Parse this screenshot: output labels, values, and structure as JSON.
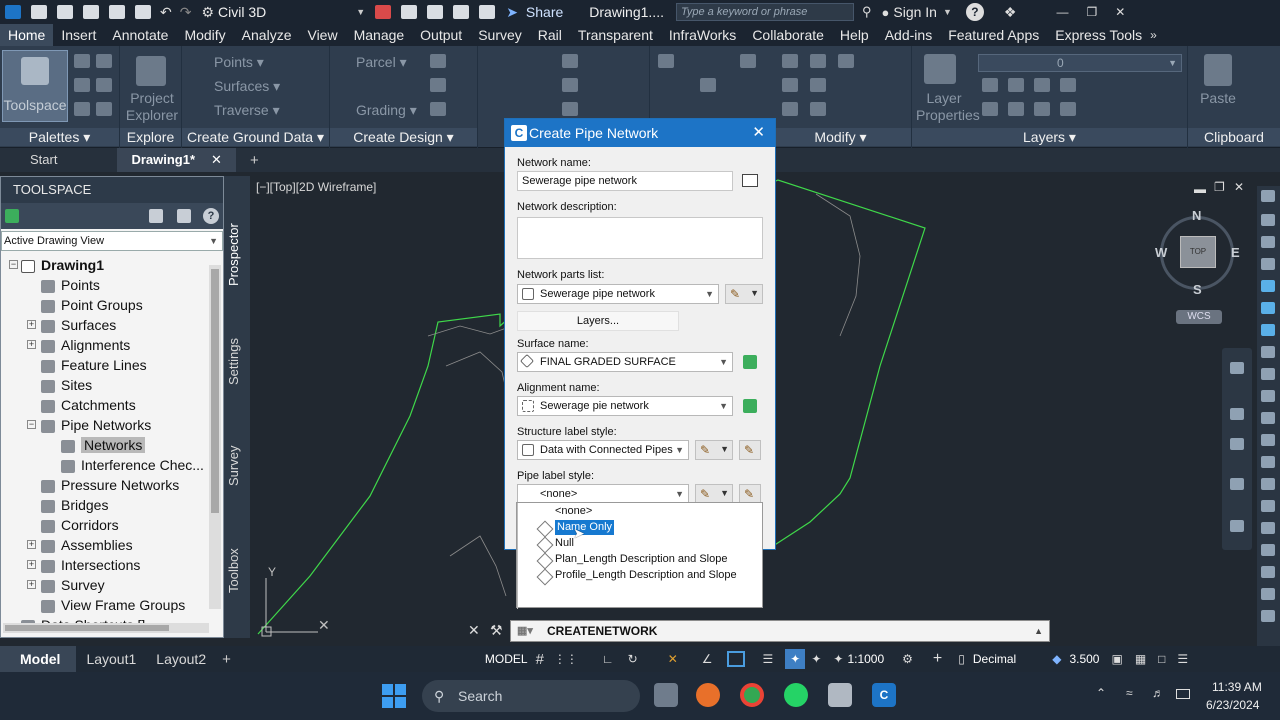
{
  "titlebar": {
    "product": "Civil 3D",
    "share": "Share",
    "document": "Drawing1....",
    "search_placeholder": "Type a keyword or phrase",
    "sign_in": "Sign In",
    "help": "?"
  },
  "ribbon_tabs": [
    "Home",
    "Insert",
    "Annotate",
    "Modify",
    "Analyze",
    "View",
    "Manage",
    "Output",
    "Survey",
    "Rail",
    "Transparent",
    "InfraWorks",
    "Collaborate",
    "Help",
    "Add-ins",
    "Featured Apps",
    "Express Tools"
  ],
  "ribbon": {
    "toolspace": "Toolspace",
    "project_explorer": "Project Explorer",
    "points": "Points",
    "surfaces": "Surfaces",
    "traverse": "Traverse",
    "parcel": "Parcel",
    "grading": "Grading",
    "layer_properties": "Layer Properties",
    "layer_value": "0",
    "paste": "Paste",
    "panels": {
      "palettes": "Palettes",
      "explore": "Explore",
      "create_ground_data": "Create Ground Data",
      "create_design": "Create Design",
      "modify": "Modify",
      "layers": "Layers",
      "clipboard": "Clipboard"
    }
  },
  "doc_tabs": {
    "start": "Start",
    "drawing": "Drawing1*"
  },
  "toolspace": {
    "title": "TOOLSPACE",
    "view": "Active Drawing View",
    "tree": [
      {
        "label": "Drawing1",
        "bold": true
      },
      {
        "label": "Points"
      },
      {
        "label": "Point Groups"
      },
      {
        "label": "Surfaces"
      },
      {
        "label": "Alignments"
      },
      {
        "label": "Feature Lines"
      },
      {
        "label": "Sites"
      },
      {
        "label": "Catchments"
      },
      {
        "label": "Pipe Networks"
      },
      {
        "label": "Networks"
      },
      {
        "label": "Interference Chec..."
      },
      {
        "label": "Pressure Networks"
      },
      {
        "label": "Bridges"
      },
      {
        "label": "Corridors"
      },
      {
        "label": "Assemblies"
      },
      {
        "label": "Intersections"
      },
      {
        "label": "Survey"
      },
      {
        "label": "View Frame Groups"
      },
      {
        "label": "Data Shortcuts []"
      }
    ],
    "side_tabs": [
      "Prospector",
      "Settings",
      "Survey",
      "Toolbox"
    ]
  },
  "viewport": {
    "label": "[−][Top][2D Wireframe]",
    "compass": {
      "n": "N",
      "s": "S",
      "e": "E",
      "w": "W",
      "top": "TOP"
    },
    "wcs": "WCS"
  },
  "dialog": {
    "title": "Create Pipe Network",
    "network_name_label": "Network name:",
    "network_name": "Sewerage pipe network",
    "network_description_label": "Network description:",
    "network_description": "",
    "parts_list_label": "Network parts list:",
    "parts_list": "Sewerage pipe network",
    "layers_button": "Layers...",
    "surface_label": "Surface name:",
    "surface": "FINAL GRADED SURFACE",
    "alignment_label": "Alignment name:",
    "alignment": "Sewerage pie network",
    "structure_label_style_label": "Structure label style:",
    "structure_label_style": "Data with Connected Pipes",
    "pipe_label_style_label": "Pipe label style:",
    "pipe_label_style": "<none>",
    "options": [
      "<none>",
      "Name Only",
      "Null",
      "Plan_Length Description and Slope",
      "Profile_Length Description and Slope"
    ],
    "highlighted_option": "Name Only"
  },
  "command_line": "CREATENETWORK",
  "statusbar": {
    "model": "Model",
    "layout1": "Layout1",
    "layout2": "Layout2",
    "model_btn": "MODEL",
    "scale": "1:1000",
    "units": "Decimal",
    "value": "3.500"
  },
  "taskbar": {
    "search": "Search",
    "time": "11:39 AM",
    "date": "6/23/2024"
  }
}
